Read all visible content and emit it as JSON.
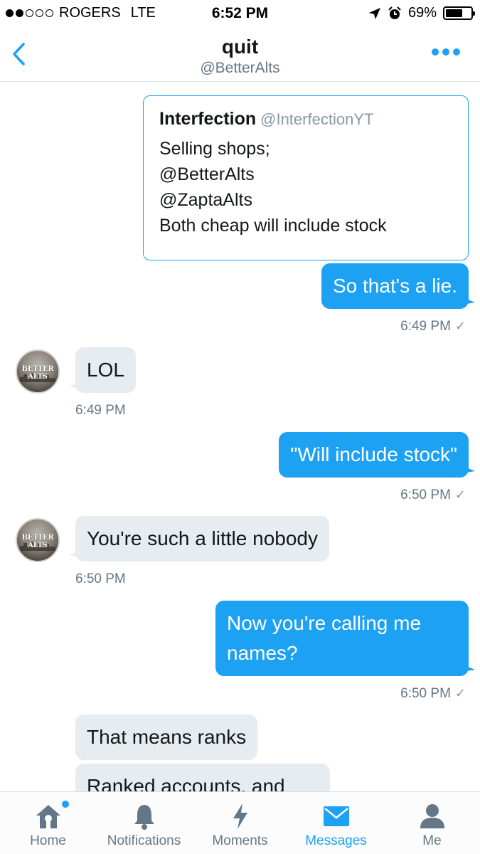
{
  "status_bar": {
    "carrier": "ROGERS",
    "network": "LTE",
    "time": "6:52 PM",
    "battery": "69%",
    "battery_level": 0.69,
    "signal_bars_filled": 2,
    "signal_bars_total": 5
  },
  "header": {
    "title": "quit",
    "subtitle": "@BetterAlts"
  },
  "quoted_tweet": {
    "author": "Interfection",
    "handle": "@InterfectionYT",
    "text": "Selling shops;\n@BetterAlts\n@ZaptaAlts\nBoth cheap will include stock"
  },
  "messages": [
    {
      "direction": "out",
      "text": "So that's a lie.",
      "time": "6:49 PM"
    },
    {
      "direction": "in",
      "text": "LOL",
      "time": "6:49 PM"
    },
    {
      "direction": "out",
      "text": "\"Will include stock\"",
      "time": "6:50 PM"
    },
    {
      "direction": "in",
      "text": "You're such a little nobody",
      "time": "6:50 PM"
    },
    {
      "direction": "out",
      "text": "Now you're calling me names?",
      "time": "6:50 PM"
    },
    {
      "direction": "in",
      "text": "That means ranks"
    },
    {
      "direction": "in",
      "text": "Ranked accounts, and"
    }
  ],
  "avatar_logo": "BETTER ALTS",
  "tabs": [
    {
      "label": "Home",
      "icon": "home-icon",
      "badge": true
    },
    {
      "label": "Notifications",
      "icon": "bell-icon"
    },
    {
      "label": "Moments",
      "icon": "lightning-icon"
    },
    {
      "label": "Messages",
      "icon": "envelope-icon",
      "active": true
    },
    {
      "label": "Me",
      "icon": "person-icon"
    }
  ],
  "colors": {
    "accent": "#1da1f2",
    "incoming_bubble": "#e6ecf0",
    "secondary_text": "#657786"
  }
}
